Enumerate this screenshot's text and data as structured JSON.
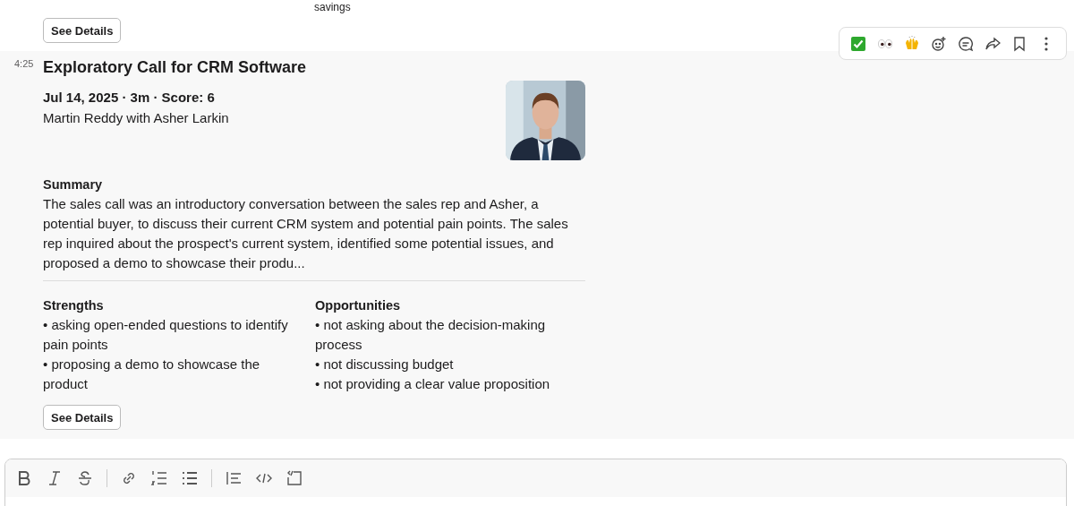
{
  "previous_message": {
    "text_fragment": "savings",
    "button": "See Details"
  },
  "message": {
    "time": "4:25",
    "title": "Exploratory Call for CRM Software",
    "meta": "Jul 14, 2025 · 3m · Score: 6",
    "participants": "Martin Reddy with Asher Larkin",
    "summary_heading": "Summary",
    "summary": "The sales call was an introductory conversation between the sales rep and Asher, a potential buyer, to discuss their current CRM system and potential pain points. The sales rep inquired about the prospect's current system, identified some potential issues, and proposed a demo to showcase their produ...",
    "columns": [
      {
        "heading": "Strengths",
        "items": [
          "• asking open-ended questions to identify pain points",
          "• proposing a demo to showcase the product"
        ]
      },
      {
        "heading": "Opportunities",
        "items": [
          "• not asking about the decision-making process",
          "• not discussing budget",
          "• not providing a clear value proposition"
        ]
      }
    ],
    "button": "See Details"
  },
  "message_actions": [
    {
      "kind": "check"
    },
    {
      "kind": "eyes"
    },
    {
      "kind": "hands"
    },
    {
      "kind": "add-reaction"
    },
    {
      "kind": "reply"
    },
    {
      "kind": "forward"
    },
    {
      "kind": "bookmark"
    },
    {
      "kind": "more"
    }
  ],
  "composer": {
    "toolbar": [
      {
        "kind": "bold"
      },
      {
        "kind": "italic"
      },
      {
        "kind": "strike"
      },
      {
        "kind": "divider"
      },
      {
        "kind": "link"
      },
      {
        "kind": "numbered"
      },
      {
        "kind": "bulleted"
      },
      {
        "kind": "divider"
      },
      {
        "kind": "quote"
      },
      {
        "kind": "code"
      },
      {
        "kind": "codeblock"
      }
    ]
  }
}
